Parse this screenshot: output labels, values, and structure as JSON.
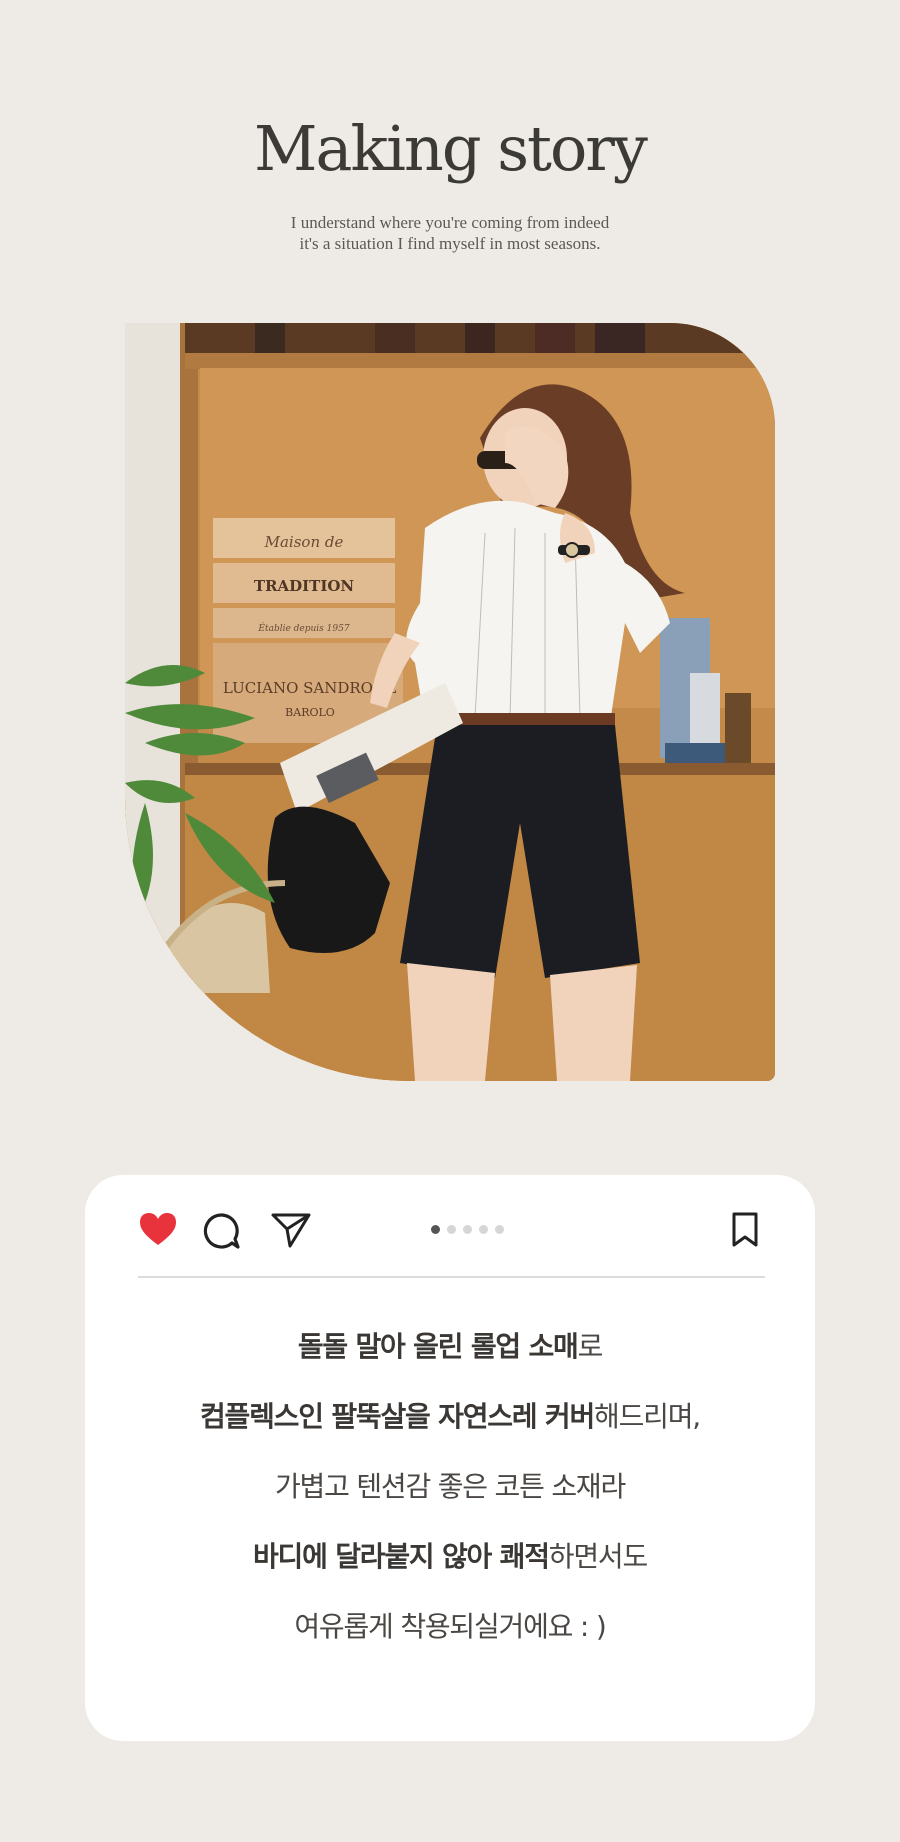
{
  "header": {
    "title": "Making story",
    "subtitle_line1": "I understand where you're coming from indeed",
    "subtitle_line2": "it's a situation I find myself in most seasons."
  },
  "photo": {
    "crate_text_1": "Maison de",
    "crate_text_2": "TRADITION",
    "crate_text_3": "Établie depuis 1957",
    "crate_text_4": "LUCIANO SANDRONE",
    "crate_text_5": "BAROLO"
  },
  "card": {
    "carousel": {
      "total": 5,
      "active_index": 0
    },
    "caption": [
      {
        "bold": "돌돌 말아 올린 롤업 소매",
        "normal": "로"
      },
      {
        "bold": "컴플렉스인 팔뚝살을 자연스레 커버",
        "normal": "해드리며,"
      },
      {
        "bold": "",
        "normal": "가볍고 텐션감 좋은 코튼 소재라"
      },
      {
        "bold": "바디에 달라붙지 않아 쾌적",
        "normal": "하면서도"
      },
      {
        "bold": "",
        "normal": "여유롭게 착용되실거에요 : )"
      }
    ]
  },
  "colors": {
    "background": "#eeebe6",
    "heart": "#e8323c",
    "card": "#ffffff"
  }
}
